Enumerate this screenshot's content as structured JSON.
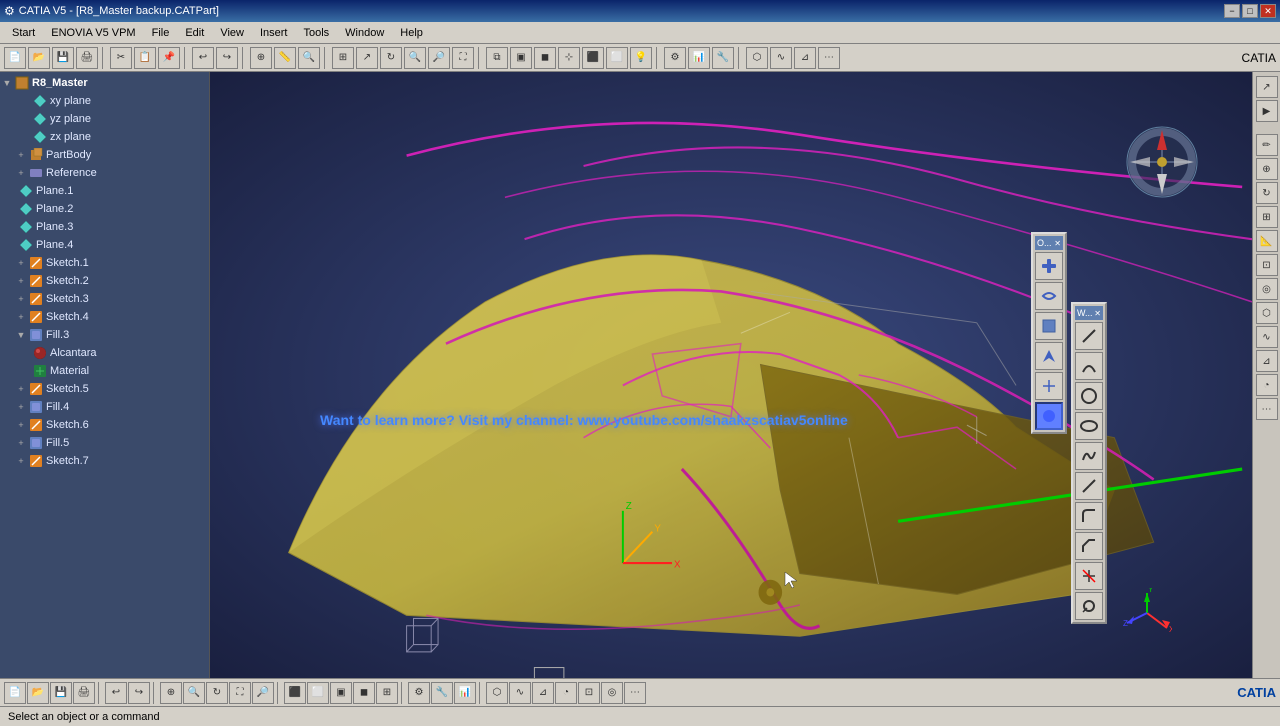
{
  "titlebar": {
    "icon": "catia-icon",
    "title": "CATIA V5 - [R8_Master backup.CATPart]",
    "minimize": "−",
    "maximize": "□",
    "close": "✕"
  },
  "menubar": {
    "items": [
      "Start",
      "ENOVIA V5 VPM",
      "File",
      "Edit",
      "View",
      "Insert",
      "Tools",
      "Window",
      "Help"
    ]
  },
  "tree": {
    "root": "R8_Master",
    "items": [
      {
        "label": "xy plane",
        "type": "plane",
        "indent": 1,
        "expanded": false
      },
      {
        "label": "yz plane",
        "type": "plane",
        "indent": 1,
        "expanded": false
      },
      {
        "label": "zx plane",
        "type": "plane",
        "indent": 1,
        "expanded": false
      },
      {
        "label": "PartBody",
        "type": "part",
        "indent": 1,
        "expanded": false
      },
      {
        "label": "Reference",
        "type": "fill",
        "indent": 1,
        "expanded": false
      },
      {
        "label": "Plane.1",
        "type": "plane",
        "indent": 1,
        "expanded": false
      },
      {
        "label": "Plane.2",
        "type": "plane",
        "indent": 1,
        "expanded": false
      },
      {
        "label": "Plane.3",
        "type": "plane",
        "indent": 1,
        "expanded": false
      },
      {
        "label": "Plane.4",
        "type": "plane",
        "indent": 1,
        "expanded": false
      },
      {
        "label": "Sketch.1",
        "type": "sketch",
        "indent": 1,
        "expanded": false
      },
      {
        "label": "Sketch.2",
        "type": "sketch",
        "indent": 1,
        "expanded": false
      },
      {
        "label": "Sketch.3",
        "type": "sketch",
        "indent": 1,
        "expanded": false
      },
      {
        "label": "Sketch.4",
        "type": "sketch",
        "indent": 1,
        "expanded": false
      },
      {
        "label": "Fill.3",
        "type": "fill",
        "indent": 1,
        "expanded": true
      },
      {
        "label": "Alcantara",
        "type": "sphere",
        "indent": 2,
        "expanded": false
      },
      {
        "label": "Material",
        "type": "material",
        "indent": 2,
        "expanded": false
      },
      {
        "label": "Sketch.5",
        "type": "sketch",
        "indent": 1,
        "expanded": false
      },
      {
        "label": "Fill.4",
        "type": "fill",
        "indent": 1,
        "expanded": false
      },
      {
        "label": "Sketch.6",
        "type": "sketch",
        "indent": 1,
        "expanded": false
      },
      {
        "label": "Fill.5",
        "type": "fill",
        "indent": 1,
        "expanded": false
      },
      {
        "label": "Sketch.7",
        "type": "sketch",
        "indent": 1,
        "expanded": false
      }
    ]
  },
  "viewport": {
    "promo_text": "Want to learn more? Visit my channel: www.youtube.com/shaakzscatiav5online"
  },
  "statusbar": {
    "message": "Select an object or a command"
  },
  "toolbar_right1": {
    "title": "O...",
    "buttons": [
      "⊞",
      "🔄",
      "📦",
      "📐",
      "🔍",
      "◉"
    ]
  },
  "toolbar_right2": {
    "title": "W...",
    "buttons": [
      "—",
      "/",
      "○",
      "□",
      "⌒",
      "△",
      "⬡",
      "∿",
      "◎",
      "⌀"
    ]
  },
  "colors": {
    "background_top": "#2a3560",
    "background_bottom": "#1a2040",
    "car_body": "#c8b840",
    "curve_color": "#e020c0",
    "green_line": "#00cc00",
    "promo_color": "#4488ff"
  }
}
